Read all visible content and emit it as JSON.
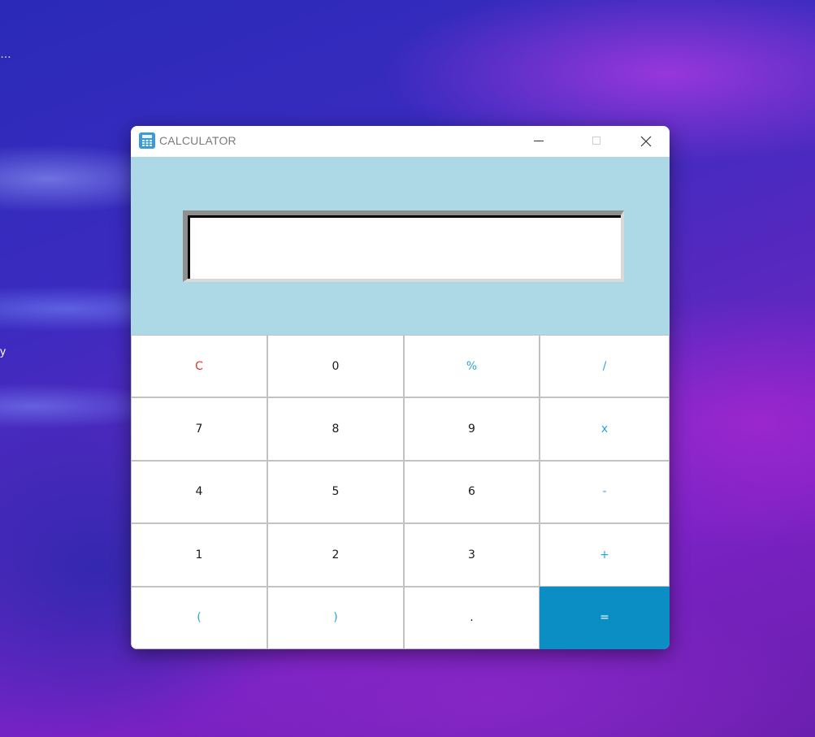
{
  "desktop": {
    "fragments": [
      "…",
      "y"
    ]
  },
  "window": {
    "title": "CALCULATOR"
  },
  "display": {
    "value": ""
  },
  "keys": [
    {
      "label": "C",
      "name": "clear-button",
      "kind": "clear"
    },
    {
      "label": "0",
      "name": "digit-0-button",
      "kind": "digit"
    },
    {
      "label": "%",
      "name": "percent-button",
      "kind": "op"
    },
    {
      "label": "/",
      "name": "divide-button",
      "kind": "op"
    },
    {
      "label": "7",
      "name": "digit-7-button",
      "kind": "digit"
    },
    {
      "label": "8",
      "name": "digit-8-button",
      "kind": "digit"
    },
    {
      "label": "9",
      "name": "digit-9-button",
      "kind": "digit"
    },
    {
      "label": "x",
      "name": "multiply-button",
      "kind": "op"
    },
    {
      "label": "4",
      "name": "digit-4-button",
      "kind": "digit"
    },
    {
      "label": "5",
      "name": "digit-5-button",
      "kind": "digit"
    },
    {
      "label": "6",
      "name": "digit-6-button",
      "kind": "digit"
    },
    {
      "label": "-",
      "name": "subtract-button",
      "kind": "op"
    },
    {
      "label": "1",
      "name": "digit-1-button",
      "kind": "digit"
    },
    {
      "label": "2",
      "name": "digit-2-button",
      "kind": "digit"
    },
    {
      "label": "3",
      "name": "digit-3-button",
      "kind": "digit"
    },
    {
      "label": "+",
      "name": "add-button",
      "kind": "op"
    },
    {
      "label": "(",
      "name": "open-paren-button",
      "kind": "op"
    },
    {
      "label": ")",
      "name": "close-paren-button",
      "kind": "op"
    },
    {
      "label": ".",
      "name": "decimal-point-button",
      "kind": "digit"
    },
    {
      "label": "=",
      "name": "equals-button",
      "kind": "equals"
    }
  ],
  "colors": {
    "display_background": "#add8e6",
    "operator_text": "#2aa6d9",
    "clear_text": "#e8312f",
    "equals_background": "#0a8ec3",
    "equals_text": "#ffffff"
  },
  "icons": {
    "app": "calculator-icon",
    "minimize": "minimize-icon",
    "maximize": "maximize-icon",
    "close": "close-icon"
  }
}
